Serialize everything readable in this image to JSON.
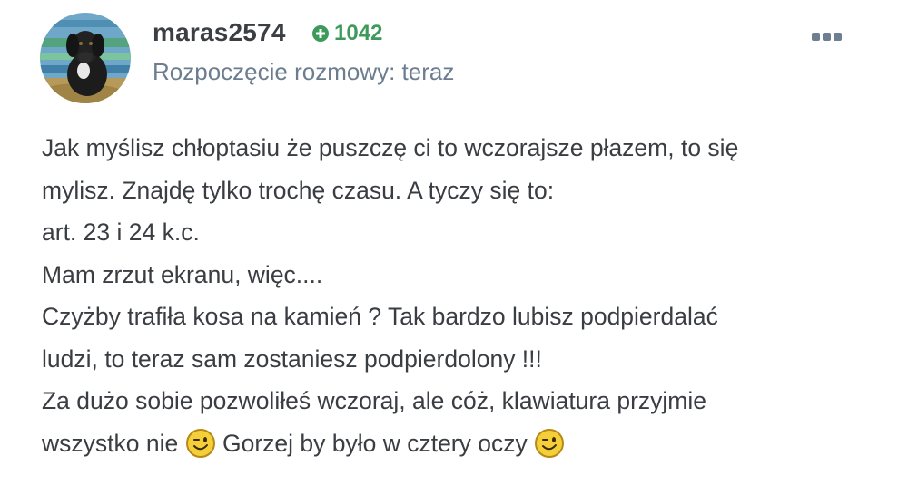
{
  "post": {
    "username": "maras2574",
    "reputation": "1042",
    "subtitle": "Rozpoczęcie rozmowy: teraz",
    "lines": [
      "Jak myślisz chłoptasiu że puszczę ci to wczorajsze płazem, to się",
      "mylisz. Znajdę tylko trochę czasu. A tyczy się to:",
      "art. 23 i 24 k.c.",
      "Mam zrzut ekranu, więc....",
      "Czyżby trafiła kosa na kamień ? Tak bardzo lubisz podpierdalać",
      "ludzi, to teraz sam zostaniesz podpierdolony !!!",
      "Za dużo sobie pozwoliłeś wczoraj, ale cóż, klawiatura przyjmie"
    ],
    "last_line_part1": "wszystko nie",
    "last_line_part2": "Gorzej by było w cztery oczy"
  },
  "colors": {
    "username": "#3b3f44",
    "reputation": "#3d9a5a",
    "subtitle": "#6b7d8e",
    "text": "#3a3d42"
  },
  "icons": {
    "avatar": "dog-photo",
    "reputation": "plus-circle-icon",
    "menu": "more-icon",
    "emoji": "winking-smiley-emoji"
  }
}
